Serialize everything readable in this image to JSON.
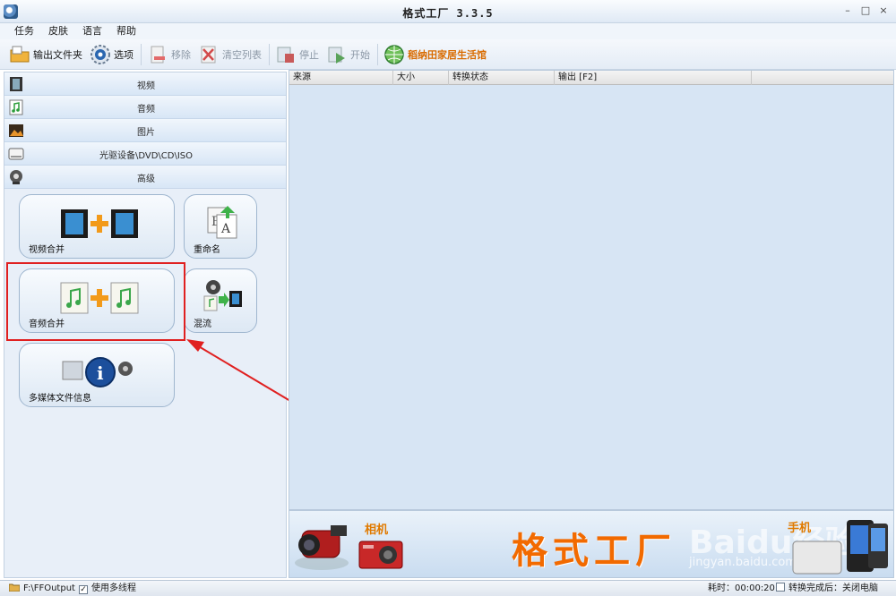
{
  "window": {
    "title": "格式工厂 3.3.5",
    "controls": [
      "–",
      "□",
      "×"
    ]
  },
  "menu": [
    "任务",
    "皮肤",
    "语言",
    "帮助"
  ],
  "toolbar": {
    "output_folder": "输出文件夹",
    "options": "选项",
    "remove": "移除",
    "clear_list": "清空列表",
    "stop": "停止",
    "start": "开始",
    "promo_link": "稻纳田家居生活馆"
  },
  "categories": [
    {
      "label": "视频",
      "icon": "film-icon"
    },
    {
      "label": "音频",
      "icon": "music-icon"
    },
    {
      "label": "图片",
      "icon": "picture-icon"
    },
    {
      "label": "光驱设备\\DVD\\CD\\ISO",
      "icon": "disc-drive-icon"
    },
    {
      "label": "高级",
      "icon": "advanced-icon"
    }
  ],
  "tools": {
    "video_merge": "视频合并",
    "rename": "重命名",
    "audio_merge": "音频合并",
    "mux": "混流",
    "media_info": "多媒体文件信息"
  },
  "task_table": {
    "headers": [
      "来源",
      "大小",
      "转换状态",
      "输出 [F2]"
    ]
  },
  "banner": {
    "camera": "相机",
    "brand": "格式工厂",
    "phone": "手机",
    "watermark": "Baidu经验",
    "watermark_sub": "jingyan.baidu.com"
  },
  "status": {
    "output_path": "F:\\FFOutput",
    "multithread": "使用多线程",
    "elapsed": "耗时：00:00:20",
    "after_done": "转换完成后：关闭电脑"
  },
  "colors": {
    "highlight": "#e02020",
    "brand": "#f26a00",
    "link": "#d96b00"
  }
}
